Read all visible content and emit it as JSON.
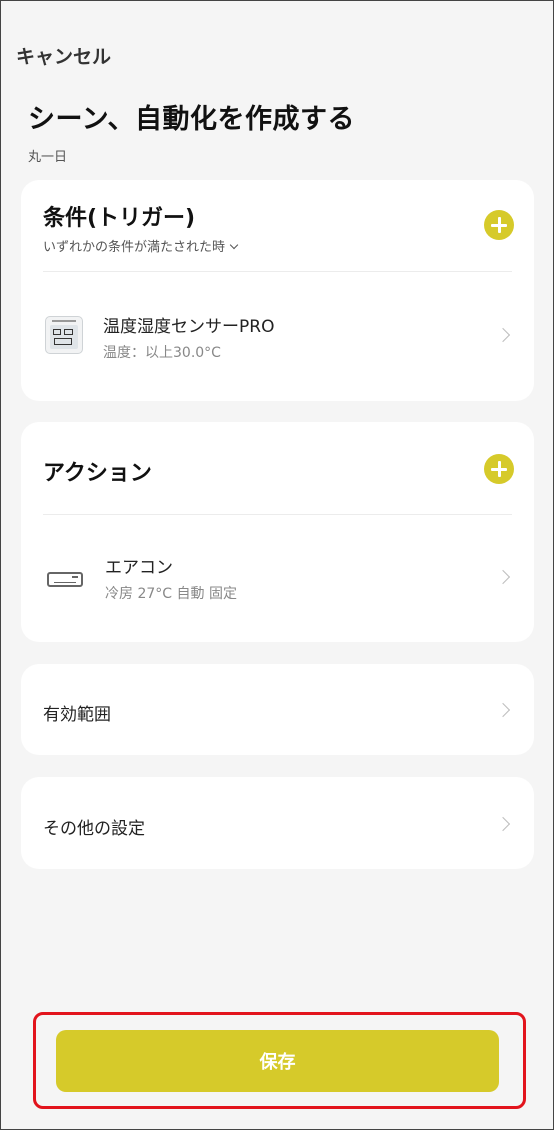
{
  "header": {
    "cancel_label": "キャンセル",
    "title": "シーン、自動化を作成する",
    "subtitle": "丸一日"
  },
  "conditions": {
    "heading": "条件(トリガー)",
    "mode": "いずれかの条件が満たされた時",
    "items": [
      {
        "icon": "temperature-sensor-icon",
        "name": "温度湿度センサーPRO",
        "detail": "温度：以上30.0°C"
      }
    ]
  },
  "actions": {
    "heading": "アクション",
    "items": [
      {
        "icon": "air-conditioner-icon",
        "name": "エアコン",
        "detail": "冷房 27°C 自動 固定"
      }
    ]
  },
  "settings": {
    "scope_label": "有効範囲",
    "other_label": "その他の設定"
  },
  "footer": {
    "save_label": "保存"
  },
  "colors": {
    "accent": "#d6ca2a",
    "highlight": "#e2141c",
    "background": "#f5f5f5"
  }
}
